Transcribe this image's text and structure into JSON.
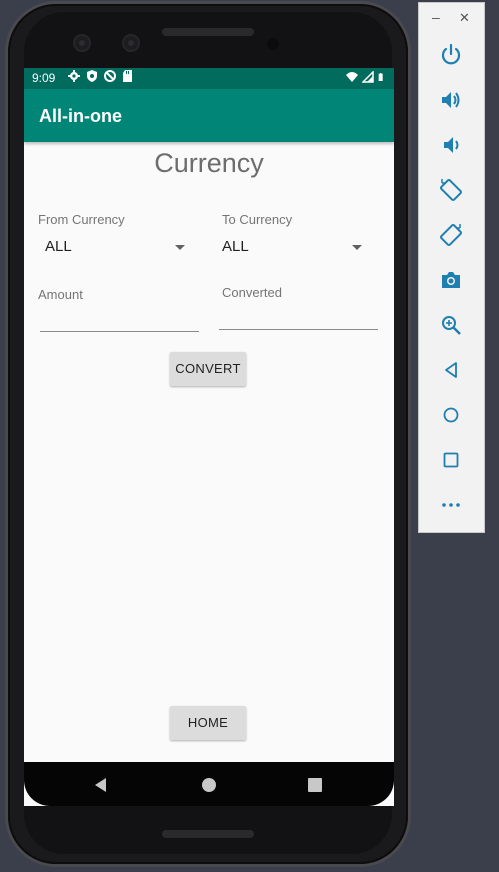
{
  "status_bar": {
    "time": "9:09",
    "background": "#016b5e",
    "icons_left": [
      "settings-icon",
      "shield-icon",
      "no-signal-icon",
      "sd-card-icon"
    ],
    "icons_right": [
      "wifi-icon",
      "cell-signal-icon",
      "battery-icon"
    ]
  },
  "app_bar": {
    "title": "All-in-one",
    "background": "#008577"
  },
  "main": {
    "title": "Currency",
    "from_currency": {
      "label": "From Currency",
      "selected": "ALL"
    },
    "to_currency": {
      "label": "To Currency",
      "selected": "ALL"
    },
    "amount": {
      "label": "Amount",
      "value": ""
    },
    "converted": {
      "label": "Converted",
      "value": ""
    },
    "convert_button": "CONVERT",
    "home_button": "HOME"
  },
  "nav_bar": {
    "buttons": [
      "back-icon",
      "home-icon",
      "recents-icon"
    ]
  },
  "emulator_panel": {
    "window_controls": [
      "minimize-icon",
      "close-icon"
    ],
    "buttons": [
      "power-icon",
      "volume-up-icon",
      "volume-down-icon",
      "rotate-left-icon",
      "rotate-right-icon",
      "camera-icon",
      "zoom-icon",
      "back-icon",
      "home-icon",
      "overview-icon",
      "more-icon"
    ]
  }
}
